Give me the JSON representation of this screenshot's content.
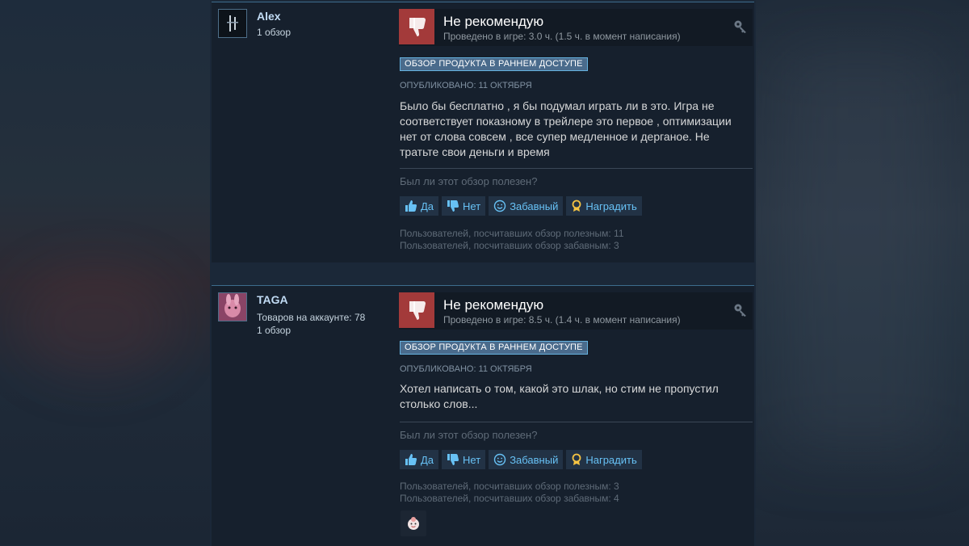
{
  "reviews": [
    {
      "author": "Alex",
      "account_lines": [
        "1 обзор"
      ],
      "verdict": "Не рекомендую",
      "hours": "Проведено в игре: 3.0 ч. (1.5 ч. в момент написания)",
      "early_access_badge": "ОБЗОР ПРОДУКТА В РАННЕМ ДОСТУПЕ",
      "posted": "Опубликовано: 11 октября",
      "content_lines": [
        "Было бы бесплатно , я бы подумал играть ли в это. Игра не",
        "соответствует показному в трейлере это первое , оптимизации",
        "нет от слова совсем , все супер медленное и дерганое. Не",
        "тратьте свои деньги и время"
      ],
      "helpful_question": "Был ли этот обзор полезен?",
      "buttons": {
        "yes": "Да",
        "no": "Нет",
        "funny": "Забавный",
        "award": "Наградить"
      },
      "stats": [
        "Пользователей, посчитавших обзор полезным: 11",
        "Пользователей, посчитавших обзор забавным: 3"
      ]
    },
    {
      "author": "TAGA",
      "account_lines": [
        "Товаров на аккаунте: 78",
        "1 обзор"
      ],
      "verdict": "Не рекомендую",
      "hours": "Проведено в игре: 8.5 ч. (1.4 ч. в момент написания)",
      "early_access_badge": "ОБЗОР ПРОДУКТА В РАННЕМ ДОСТУПЕ",
      "posted": "Опубликовано: 11 октября",
      "content_lines": [
        "Хотел написать о том, какой это шлак, но стим не пропустил",
        "столько слов..."
      ],
      "helpful_question": "Был ли этот обзор полезен?",
      "buttons": {
        "yes": "Да",
        "no": "Нет",
        "funny": "Забавный",
        "award": "Наградить"
      },
      "stats": [
        "Пользователей, посчитавших обзор полезным: 3",
        "Пользователей, посчитавших обзор забавным: 4"
      ]
    }
  ],
  "colors": {
    "page_bg": "#1b2838",
    "card_bg": "#16202d",
    "thumb_down": "#a33a3a",
    "link": "#67c1f5",
    "badge_bg": "#4a6b8c"
  }
}
